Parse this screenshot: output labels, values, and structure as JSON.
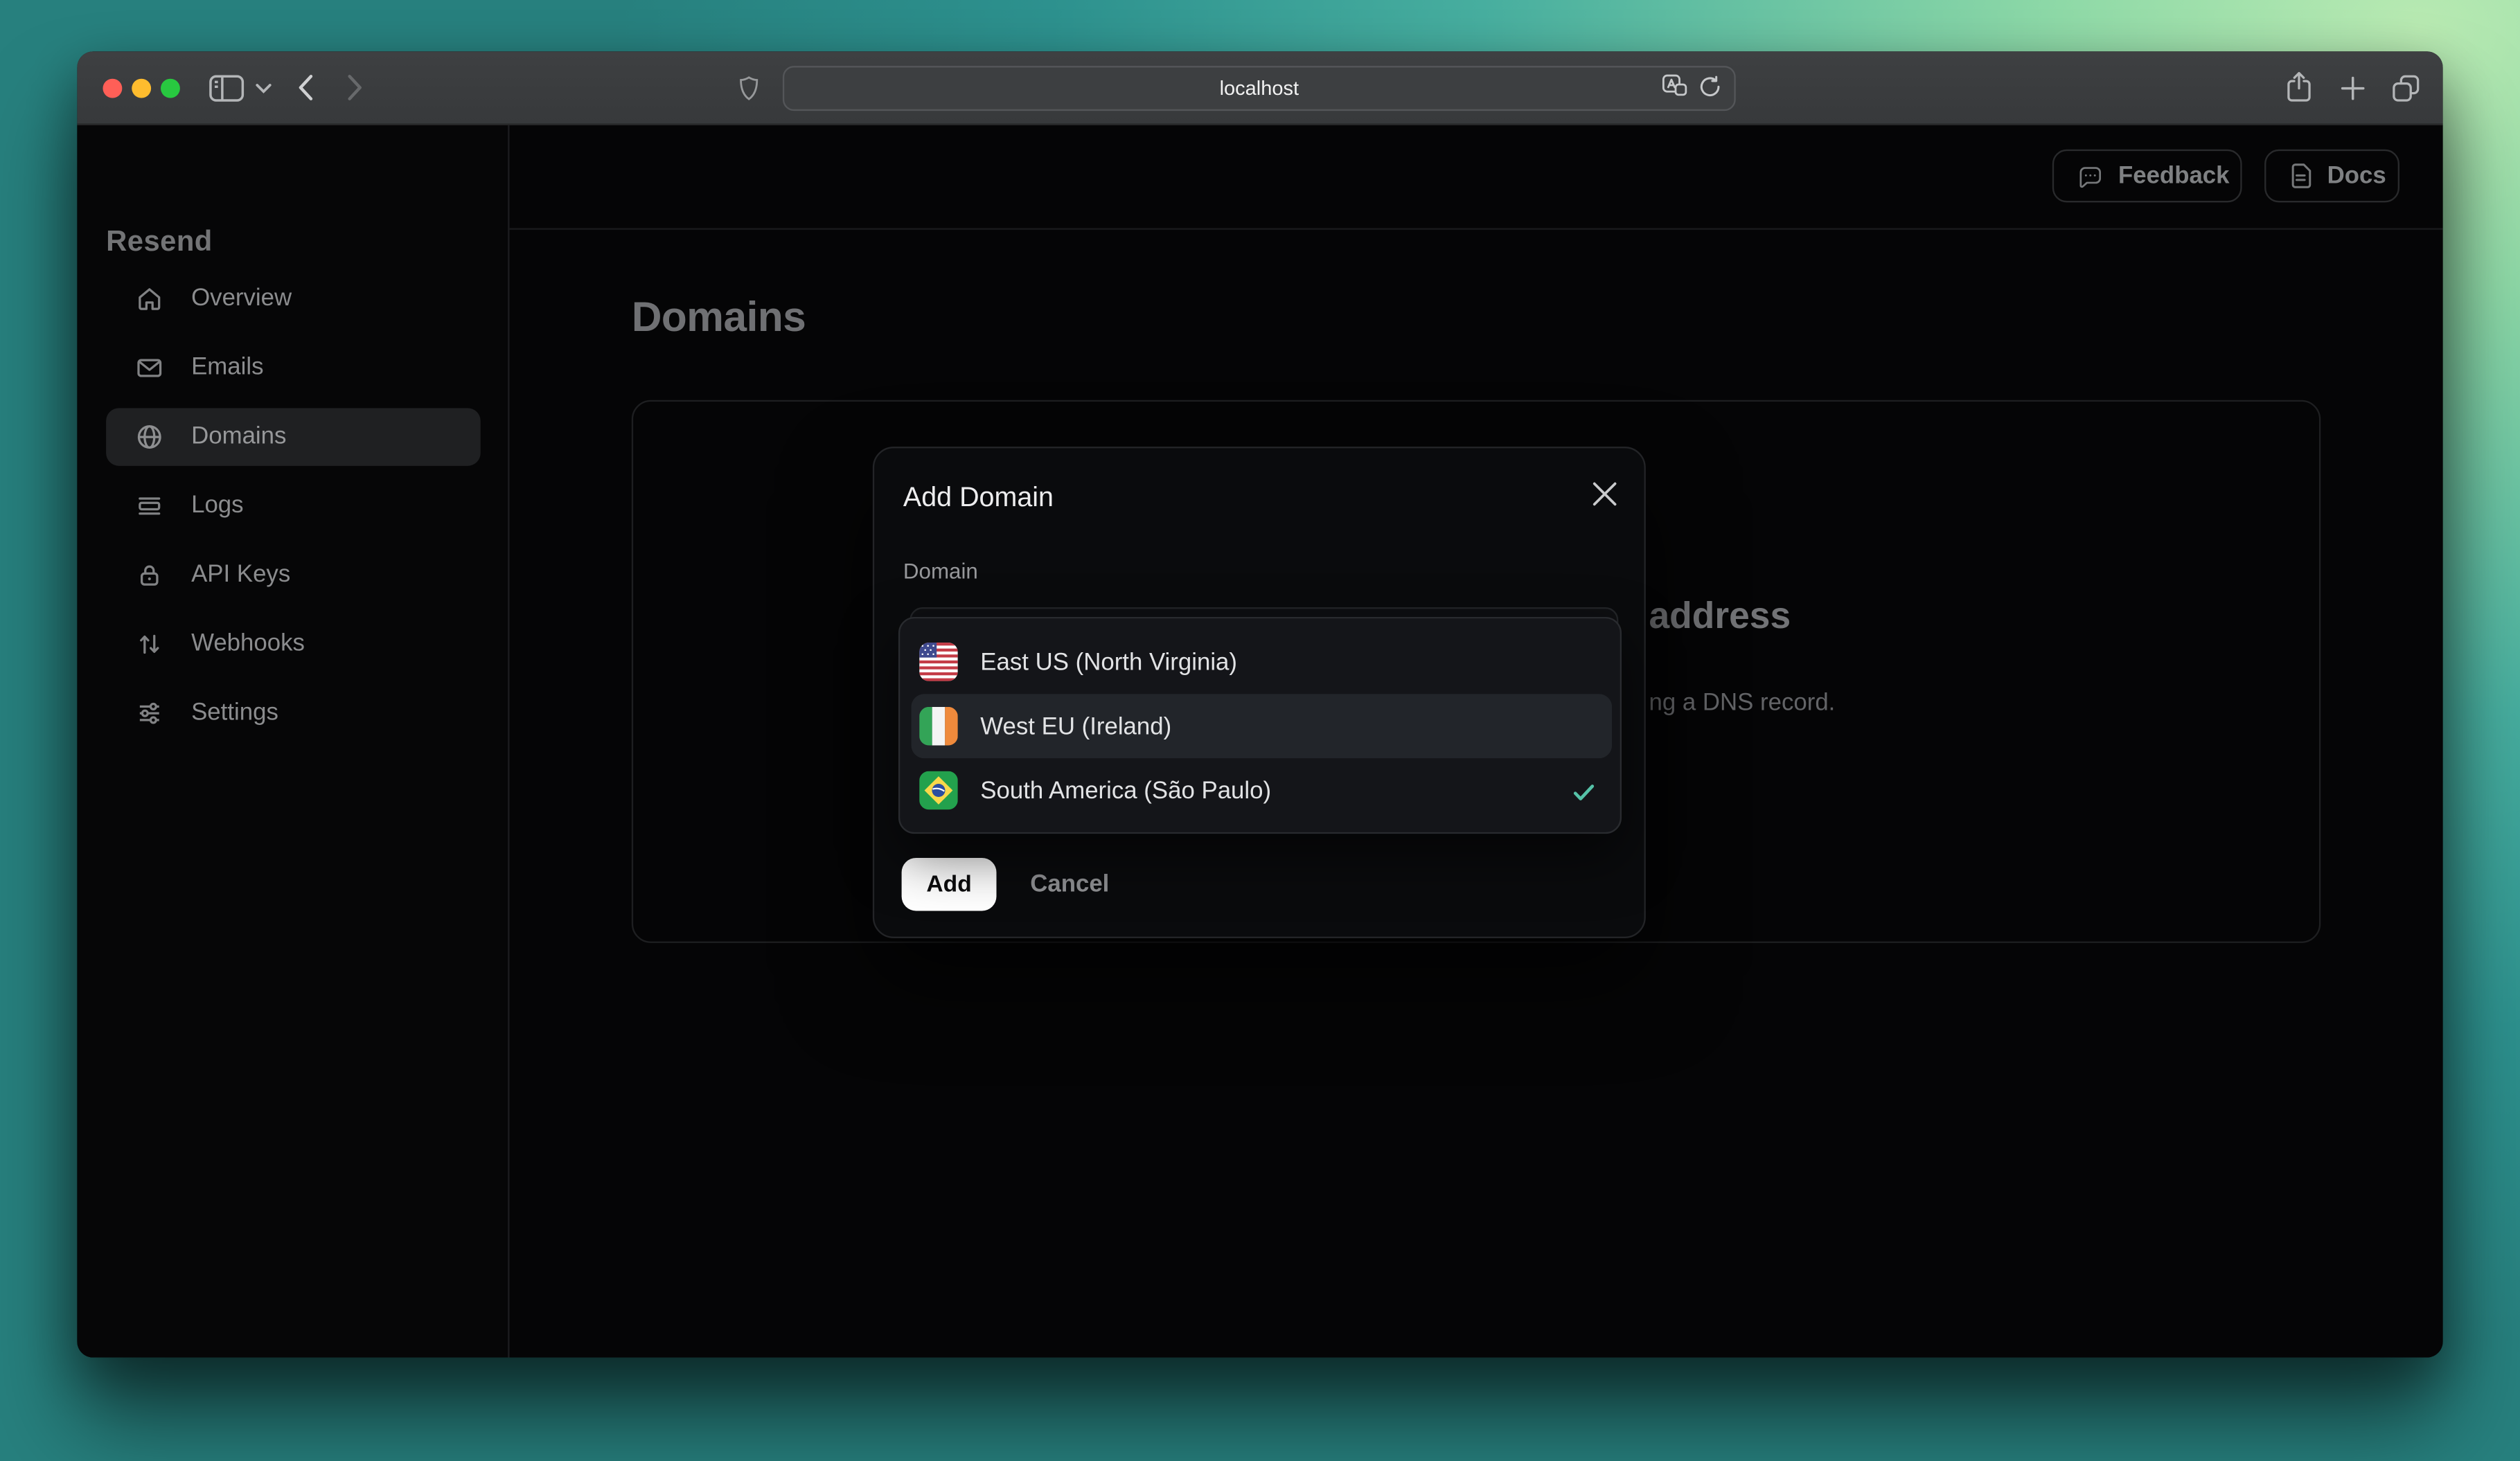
{
  "browser_chrome": {
    "address": "localhost"
  },
  "app": {
    "logo": "Resend",
    "nav": [
      {
        "label": "Overview",
        "icon": "home-icon",
        "active": false
      },
      {
        "label": "Emails",
        "icon": "envelope-icon",
        "active": false
      },
      {
        "label": "Domains",
        "icon": "globe-icon",
        "active": true
      },
      {
        "label": "Logs",
        "icon": "rows-icon",
        "active": false
      },
      {
        "label": "API Keys",
        "icon": "lock-icon",
        "active": false
      },
      {
        "label": "Webhooks",
        "icon": "arrows-up-down-icon",
        "active": false
      },
      {
        "label": "Settings",
        "icon": "sliders-icon",
        "active": false
      }
    ],
    "header_actions": [
      {
        "label": "Feedback",
        "icon": "speech-bubble-icon"
      },
      {
        "label": "Docs",
        "icon": "document-icon"
      }
    ],
    "page_title": "Domains",
    "empty_state_visible_fragments": {
      "heading": "address",
      "body": "ng a DNS record."
    }
  },
  "modal": {
    "title": "Add Domain",
    "field_label": "Domain",
    "options": [
      {
        "label": "East US (North Virginia)",
        "flag": "us",
        "highlighted": false,
        "selected": false
      },
      {
        "label": "West EU (Ireland)",
        "flag": "ie",
        "highlighted": true,
        "selected": false
      },
      {
        "label": "South America (São Paulo)",
        "flag": "br",
        "highlighted": false,
        "selected": true
      }
    ],
    "primary_button": "Add",
    "secondary_button": "Cancel"
  },
  "colors": {
    "check": "#56C2A8",
    "traffic_red": "#FF5F57",
    "traffic_yellow": "#FEBC2E",
    "traffic_green": "#28C840",
    "bg_teal": "#2D918E",
    "bg_green": "#B9EAB2"
  }
}
